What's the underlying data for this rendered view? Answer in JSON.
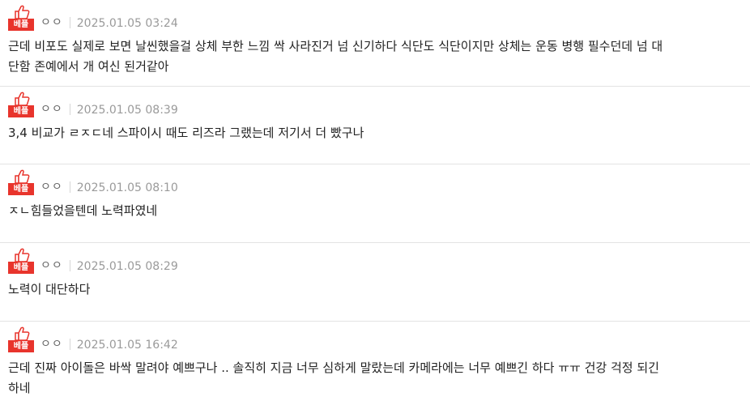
{
  "badge": {
    "label": "베플",
    "icon": "thumbs-up-icon",
    "color": "#e8342c"
  },
  "comments": [
    {
      "author": "ㅇㅇ",
      "date": "2025.01.05 03:24",
      "text": "근데 비포도 실제로 보면 날씬했을걸 상체 부한 느낌 싹 사라진거 넘 신기하다 식단도 식단이지만 상체는 운동 병행 필수던데 넘 대\n단함 존예에서 개 여신 된거같아"
    },
    {
      "author": "ㅇㅇ",
      "date": "2025.01.05 08:39",
      "text": "3,4 비교가 ㄹㅈㄷ네 스파이시 때도 리즈라 그랬는데 저기서 더 빴구나"
    },
    {
      "author": "ㅇㅇ",
      "date": "2025.01.05 08:10",
      "text": "ㅈㄴ힘들었을텐데 노력파였네"
    },
    {
      "author": "ㅇㅇ",
      "date": "2025.01.05 08:29",
      "text": "노력이 대단하다"
    },
    {
      "author": "ㅇㅇ",
      "date": "2025.01.05 16:42",
      "text": "근데 진짜 아이돌은 바싹 말려야 예쁘구나 .. 솔직히 지금 너무 심하게 말랐는데 카메라에는 너무 예쁘긴 하다 ㅠㅠ 건강 걱정 되긴\n하네"
    }
  ]
}
